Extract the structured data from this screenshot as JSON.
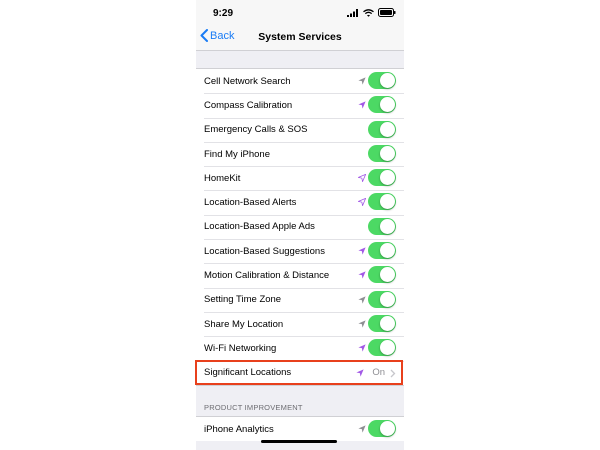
{
  "status_bar": {
    "time": "9:29"
  },
  "nav": {
    "back_label": "Back",
    "title": "System Services"
  },
  "colors": {
    "toggle_on": "#4cd964",
    "accent": "#1a7cf5",
    "location_arrow_active": "#a259e6",
    "location_arrow_recent": "#8e8e93",
    "highlight": "#e8401c"
  },
  "services": [
    {
      "label": "Cell Network Search",
      "arrow": "gray-filled",
      "on": true
    },
    {
      "label": "Compass Calibration",
      "arrow": "purple-filled",
      "on": true
    },
    {
      "label": "Emergency Calls & SOS",
      "arrow": "none",
      "on": true
    },
    {
      "label": "Find My iPhone",
      "arrow": "none",
      "on": true
    },
    {
      "label": "HomeKit",
      "arrow": "purple-outline",
      "on": true
    },
    {
      "label": "Location-Based Alerts",
      "arrow": "purple-outline",
      "on": true
    },
    {
      "label": "Location-Based Apple Ads",
      "arrow": "none",
      "on": true
    },
    {
      "label": "Location-Based Suggestions",
      "arrow": "purple-filled",
      "on": true
    },
    {
      "label": "Motion Calibration & Distance",
      "arrow": "purple-filled",
      "on": true
    },
    {
      "label": "Setting Time Zone",
      "arrow": "gray-filled",
      "on": true
    },
    {
      "label": "Share My Location",
      "arrow": "gray-filled",
      "on": true
    },
    {
      "label": "Wi-Fi Networking",
      "arrow": "purple-filled",
      "on": true
    }
  ],
  "significant_locations": {
    "label": "Significant Locations",
    "value": "On",
    "arrow": "purple-filled"
  },
  "product_improvement": {
    "header": "PRODUCT IMPROVEMENT",
    "items": [
      {
        "label": "iPhone Analytics",
        "arrow": "gray-filled",
        "on": true
      }
    ]
  }
}
